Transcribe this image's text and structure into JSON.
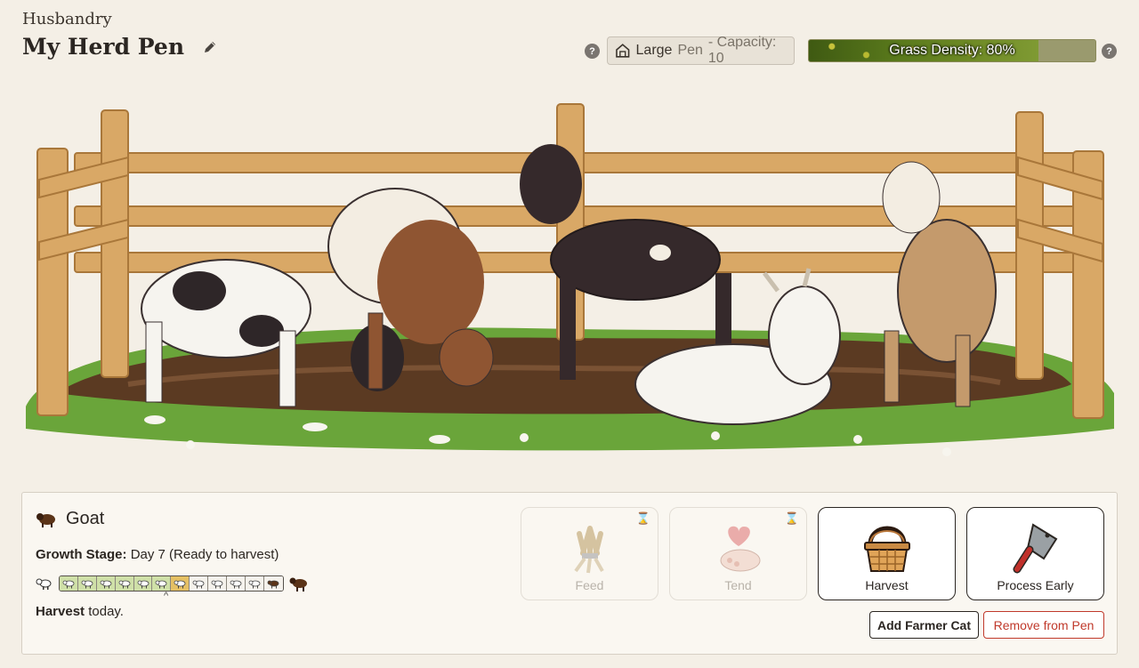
{
  "header": {
    "section": "Husbandry",
    "title": "My Herd Pen",
    "pen_size": "Large",
    "pen_word": "Pen",
    "capacity": "- Capacity: 10",
    "grass_label": "Grass Density: 80%",
    "grass_density": 0.8
  },
  "animal": {
    "name": "Goat",
    "growth_label": "Growth Stage:",
    "growth_value": "Day 7 (Ready to harvest)",
    "stages_total": 12,
    "stages_done": 6,
    "current_stage": 7,
    "caret": "^",
    "harvest_bold": "Harvest",
    "harvest_rest": " today."
  },
  "actions": [
    {
      "label": "Feed",
      "enabled": false,
      "icon": "wheat-bundle-icon"
    },
    {
      "label": "Tend",
      "enabled": false,
      "icon": "heart-paw-icon"
    },
    {
      "label": "Harvest",
      "enabled": true,
      "icon": "basket-icon"
    },
    {
      "label": "Process Early",
      "enabled": true,
      "icon": "cleaver-icon"
    }
  ],
  "buttons": {
    "add_farmer": "Add Farmer Cat",
    "remove": "Remove from Pen"
  },
  "timer_glyph": "⌛",
  "colors": {
    "accent_danger": "#c0392b",
    "stage_done": "#cfe0a8",
    "stage_current": "#e5c064"
  }
}
